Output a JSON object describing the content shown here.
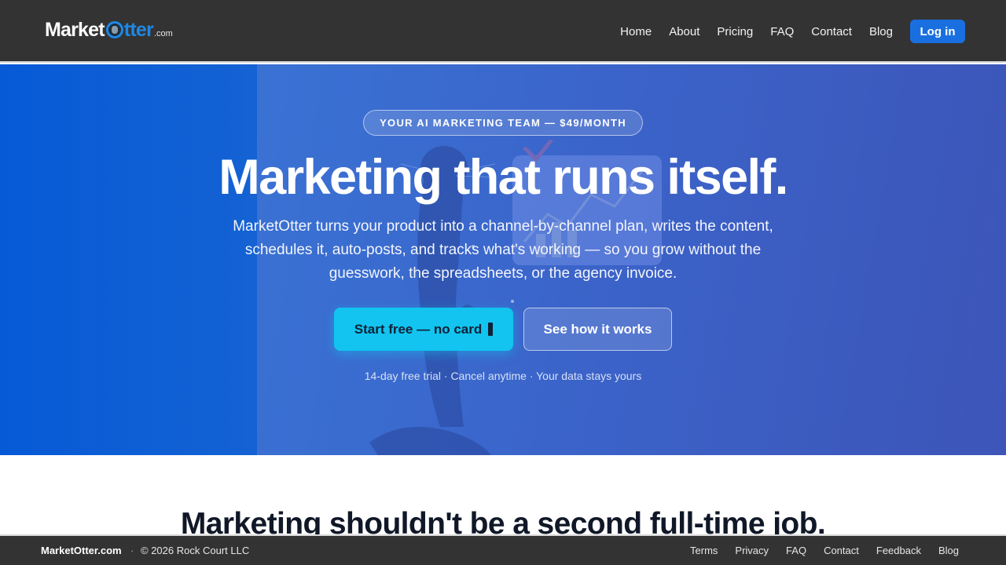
{
  "header": {
    "logo": {
      "market": "Market",
      "tter": "tter",
      "com": ".com"
    },
    "nav": [
      "Home",
      "About",
      "Pricing",
      "FAQ",
      "Contact",
      "Blog"
    ],
    "login_label": "Log in"
  },
  "hero": {
    "pill": "YOUR AI MARKETING TEAM — $49/MONTH",
    "title": "Marketing that runs itself.",
    "subtitle": "MarketOtter turns your product into a channel-by-channel plan, writes the content, schedules it, auto-posts, and tracks what's working — so you grow without the guesswork, the spreadsheets, or the agency invoice.",
    "cta_primary": "Start free — no card",
    "cta_secondary": "See how it works",
    "trust_line": "14-day free trial · Cancel anytime · Your data stays yours"
  },
  "section": {
    "title": "Marketing shouldn't be a second full-time job."
  },
  "footer": {
    "brand": "MarketOtter.com",
    "separator": "·",
    "copyright": "© 2026 Rock Court LLC",
    "links": [
      "Terms",
      "Privacy",
      "FAQ",
      "Contact",
      "Feedback",
      "Blog"
    ]
  },
  "colors": {
    "topbar": "#333333",
    "accent_blue": "#1a6fe0",
    "cta_cyan": "#12c4ef",
    "hero_start": "#0a61d6",
    "hero_end": "#3d54b6"
  }
}
